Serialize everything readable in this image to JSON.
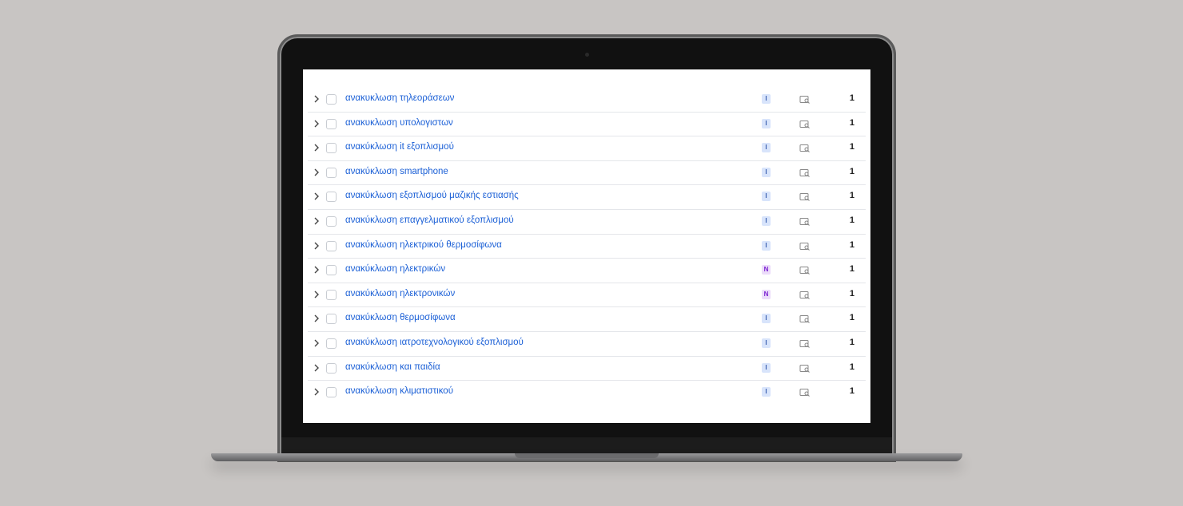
{
  "keywords": [
    {
      "keyword": "ανακυκλωση τηλεοράσεων",
      "intent": "I",
      "position": "1"
    },
    {
      "keyword": "ανακυκλωση υπολογιστων",
      "intent": "I",
      "position": "1"
    },
    {
      "keyword": "ανακύκλωση it εξοπλισμού",
      "intent": "I",
      "position": "1"
    },
    {
      "keyword": "ανακύκλωση smartphone",
      "intent": "I",
      "position": "1"
    },
    {
      "keyword": "ανακύκλωση εξοπλισμού μαζικής εστιασής",
      "intent": "I",
      "position": "1"
    },
    {
      "keyword": "ανακύκλωση επαγγελματικού εξοπλισμού",
      "intent": "I",
      "position": "1"
    },
    {
      "keyword": "ανακύκλωση ηλεκτρικού θερμοσίφωνα",
      "intent": "I",
      "position": "1"
    },
    {
      "keyword": "ανακύκλωση ηλεκτρικών",
      "intent": "N",
      "position": "1"
    },
    {
      "keyword": "ανακύκλωση ηλεκτρονικών",
      "intent": "N",
      "position": "1"
    },
    {
      "keyword": "ανακύκλωση θερμοσίφωνα",
      "intent": "I",
      "position": "1"
    },
    {
      "keyword": "ανακύκλωση ιατροτεχνολογικού εξοπλισμού",
      "intent": "I",
      "position": "1"
    },
    {
      "keyword": "ανακύκλωση και παιδία",
      "intent": "I",
      "position": "1"
    },
    {
      "keyword": "ανακύκλωση κλιματιστικού",
      "intent": "I",
      "position": "1"
    }
  ],
  "icons": {
    "expand": "chevron-right-icon",
    "serp": "serp-snapshot-icon"
  },
  "colors": {
    "link": "#1a5fd6",
    "intent_informational_bg": "#d8e4fb",
    "intent_navigational_bg": "#ecdcfa"
  }
}
